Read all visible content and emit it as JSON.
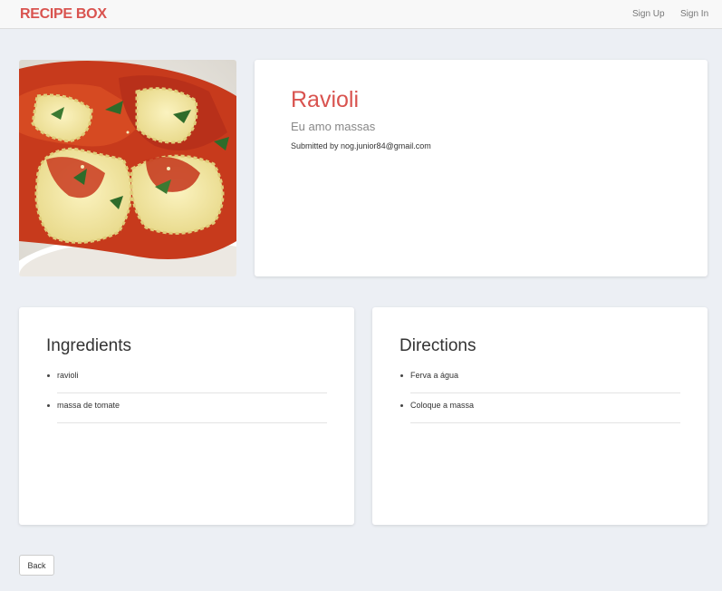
{
  "navbar": {
    "brand": "RECIPE BOX",
    "sign_up": "Sign Up",
    "sign_in": "Sign In"
  },
  "recipe": {
    "title": "Ravioli",
    "description": "Eu amo massas",
    "submitted_by": "Submitted by nog.junior84@gmail.com",
    "image_alt": "ravioli with tomato sauce"
  },
  "ingredients": {
    "heading": "Ingredients",
    "items": [
      "ravioli",
      "massa de tomate"
    ]
  },
  "directions": {
    "heading": "Directions",
    "items": [
      "Ferva a água",
      "Coloque a massa"
    ]
  },
  "actions": {
    "back": "Back"
  },
  "colors": {
    "brand": "#d9534f",
    "page_background": "#eceff4"
  }
}
